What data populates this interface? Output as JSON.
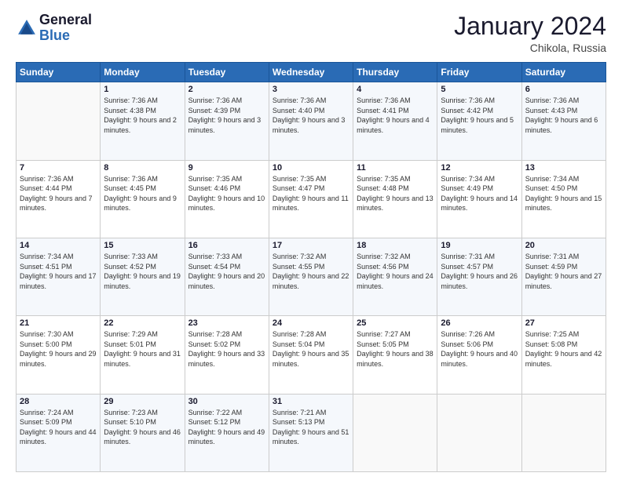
{
  "logo": {
    "text_general": "General",
    "text_blue": "Blue"
  },
  "header": {
    "month_year": "January 2024",
    "location": "Chikola, Russia"
  },
  "days_of_week": [
    "Sunday",
    "Monday",
    "Tuesday",
    "Wednesday",
    "Thursday",
    "Friday",
    "Saturday"
  ],
  "weeks": [
    [
      {
        "day": "",
        "sunrise": "",
        "sunset": "",
        "daylight": ""
      },
      {
        "day": "1",
        "sunrise": "Sunrise: 7:36 AM",
        "sunset": "Sunset: 4:38 PM",
        "daylight": "Daylight: 9 hours and 2 minutes."
      },
      {
        "day": "2",
        "sunrise": "Sunrise: 7:36 AM",
        "sunset": "Sunset: 4:39 PM",
        "daylight": "Daylight: 9 hours and 3 minutes."
      },
      {
        "day": "3",
        "sunrise": "Sunrise: 7:36 AM",
        "sunset": "Sunset: 4:40 PM",
        "daylight": "Daylight: 9 hours and 3 minutes."
      },
      {
        "day": "4",
        "sunrise": "Sunrise: 7:36 AM",
        "sunset": "Sunset: 4:41 PM",
        "daylight": "Daylight: 9 hours and 4 minutes."
      },
      {
        "day": "5",
        "sunrise": "Sunrise: 7:36 AM",
        "sunset": "Sunset: 4:42 PM",
        "daylight": "Daylight: 9 hours and 5 minutes."
      },
      {
        "day": "6",
        "sunrise": "Sunrise: 7:36 AM",
        "sunset": "Sunset: 4:43 PM",
        "daylight": "Daylight: 9 hours and 6 minutes."
      }
    ],
    [
      {
        "day": "7",
        "sunrise": "Sunrise: 7:36 AM",
        "sunset": "Sunset: 4:44 PM",
        "daylight": "Daylight: 9 hours and 7 minutes."
      },
      {
        "day": "8",
        "sunrise": "Sunrise: 7:36 AM",
        "sunset": "Sunset: 4:45 PM",
        "daylight": "Daylight: 9 hours and 9 minutes."
      },
      {
        "day": "9",
        "sunrise": "Sunrise: 7:35 AM",
        "sunset": "Sunset: 4:46 PM",
        "daylight": "Daylight: 9 hours and 10 minutes."
      },
      {
        "day": "10",
        "sunrise": "Sunrise: 7:35 AM",
        "sunset": "Sunset: 4:47 PM",
        "daylight": "Daylight: 9 hours and 11 minutes."
      },
      {
        "day": "11",
        "sunrise": "Sunrise: 7:35 AM",
        "sunset": "Sunset: 4:48 PM",
        "daylight": "Daylight: 9 hours and 13 minutes."
      },
      {
        "day": "12",
        "sunrise": "Sunrise: 7:34 AM",
        "sunset": "Sunset: 4:49 PM",
        "daylight": "Daylight: 9 hours and 14 minutes."
      },
      {
        "day": "13",
        "sunrise": "Sunrise: 7:34 AM",
        "sunset": "Sunset: 4:50 PM",
        "daylight": "Daylight: 9 hours and 15 minutes."
      }
    ],
    [
      {
        "day": "14",
        "sunrise": "Sunrise: 7:34 AM",
        "sunset": "Sunset: 4:51 PM",
        "daylight": "Daylight: 9 hours and 17 minutes."
      },
      {
        "day": "15",
        "sunrise": "Sunrise: 7:33 AM",
        "sunset": "Sunset: 4:52 PM",
        "daylight": "Daylight: 9 hours and 19 minutes."
      },
      {
        "day": "16",
        "sunrise": "Sunrise: 7:33 AM",
        "sunset": "Sunset: 4:54 PM",
        "daylight": "Daylight: 9 hours and 20 minutes."
      },
      {
        "day": "17",
        "sunrise": "Sunrise: 7:32 AM",
        "sunset": "Sunset: 4:55 PM",
        "daylight": "Daylight: 9 hours and 22 minutes."
      },
      {
        "day": "18",
        "sunrise": "Sunrise: 7:32 AM",
        "sunset": "Sunset: 4:56 PM",
        "daylight": "Daylight: 9 hours and 24 minutes."
      },
      {
        "day": "19",
        "sunrise": "Sunrise: 7:31 AM",
        "sunset": "Sunset: 4:57 PM",
        "daylight": "Daylight: 9 hours and 26 minutes."
      },
      {
        "day": "20",
        "sunrise": "Sunrise: 7:31 AM",
        "sunset": "Sunset: 4:59 PM",
        "daylight": "Daylight: 9 hours and 27 minutes."
      }
    ],
    [
      {
        "day": "21",
        "sunrise": "Sunrise: 7:30 AM",
        "sunset": "Sunset: 5:00 PM",
        "daylight": "Daylight: 9 hours and 29 minutes."
      },
      {
        "day": "22",
        "sunrise": "Sunrise: 7:29 AM",
        "sunset": "Sunset: 5:01 PM",
        "daylight": "Daylight: 9 hours and 31 minutes."
      },
      {
        "day": "23",
        "sunrise": "Sunrise: 7:28 AM",
        "sunset": "Sunset: 5:02 PM",
        "daylight": "Daylight: 9 hours and 33 minutes."
      },
      {
        "day": "24",
        "sunrise": "Sunrise: 7:28 AM",
        "sunset": "Sunset: 5:04 PM",
        "daylight": "Daylight: 9 hours and 35 minutes."
      },
      {
        "day": "25",
        "sunrise": "Sunrise: 7:27 AM",
        "sunset": "Sunset: 5:05 PM",
        "daylight": "Daylight: 9 hours and 38 minutes."
      },
      {
        "day": "26",
        "sunrise": "Sunrise: 7:26 AM",
        "sunset": "Sunset: 5:06 PM",
        "daylight": "Daylight: 9 hours and 40 minutes."
      },
      {
        "day": "27",
        "sunrise": "Sunrise: 7:25 AM",
        "sunset": "Sunset: 5:08 PM",
        "daylight": "Daylight: 9 hours and 42 minutes."
      }
    ],
    [
      {
        "day": "28",
        "sunrise": "Sunrise: 7:24 AM",
        "sunset": "Sunset: 5:09 PM",
        "daylight": "Daylight: 9 hours and 44 minutes."
      },
      {
        "day": "29",
        "sunrise": "Sunrise: 7:23 AM",
        "sunset": "Sunset: 5:10 PM",
        "daylight": "Daylight: 9 hours and 46 minutes."
      },
      {
        "day": "30",
        "sunrise": "Sunrise: 7:22 AM",
        "sunset": "Sunset: 5:12 PM",
        "daylight": "Daylight: 9 hours and 49 minutes."
      },
      {
        "day": "31",
        "sunrise": "Sunrise: 7:21 AM",
        "sunset": "Sunset: 5:13 PM",
        "daylight": "Daylight: 9 hours and 51 minutes."
      },
      {
        "day": "",
        "sunrise": "",
        "sunset": "",
        "daylight": ""
      },
      {
        "day": "",
        "sunrise": "",
        "sunset": "",
        "daylight": ""
      },
      {
        "day": "",
        "sunrise": "",
        "sunset": "",
        "daylight": ""
      }
    ]
  ]
}
